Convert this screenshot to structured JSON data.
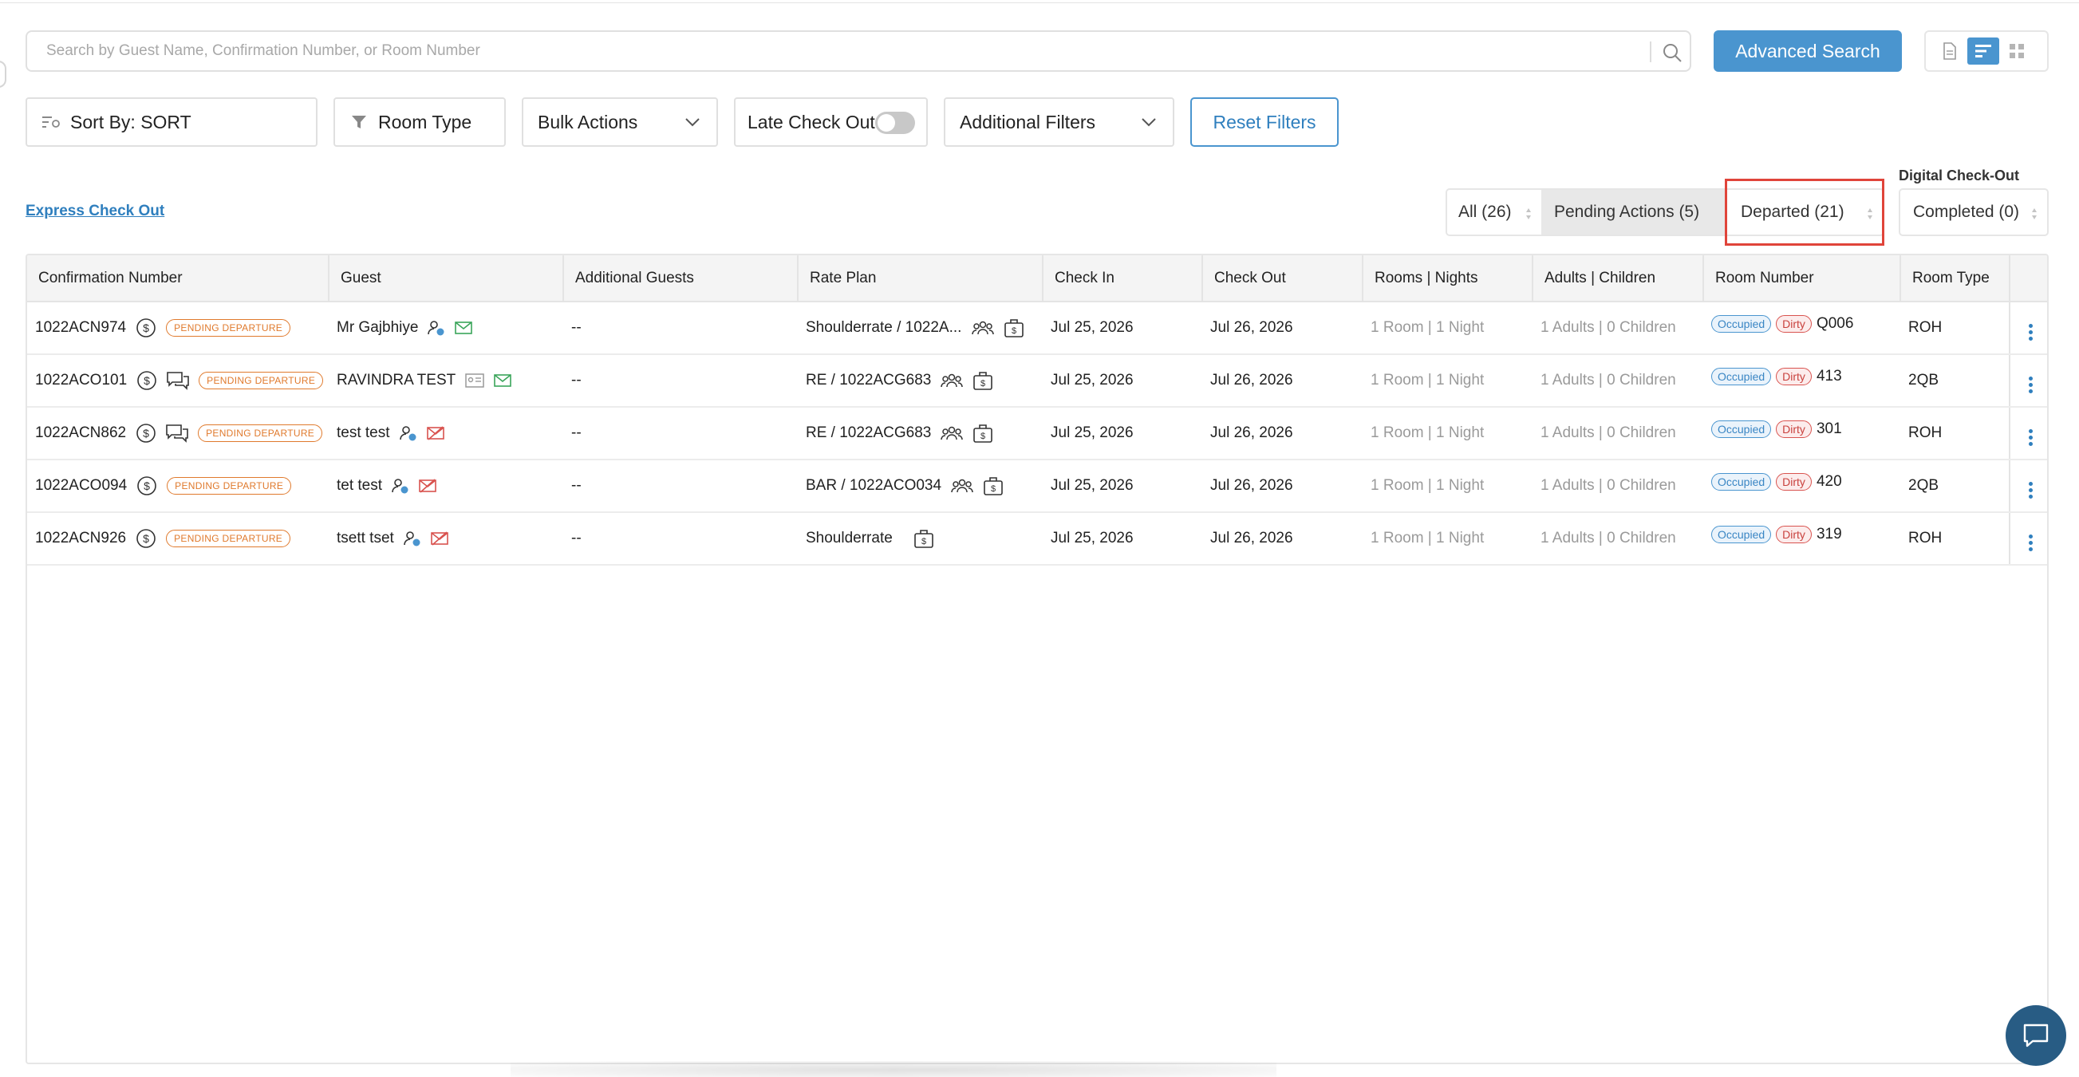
{
  "search": {
    "placeholder": "Search by Guest Name, Confirmation Number, or Room Number"
  },
  "advanced_search_label": "Advanced Search",
  "filters": {
    "sort_label": "Sort By: SORT",
    "room_type_label": "Room Type",
    "bulk_actions_label": "Bulk Actions",
    "late_checkout_label": "Late Check Out",
    "additional_filters_label": "Additional Filters",
    "reset_label": "Reset Filters"
  },
  "express_checkout_label": "Express Check Out",
  "tabs": {
    "all": "All (26)",
    "pending": "Pending Actions (5)",
    "departed": "Departed (21)",
    "digital_checkout_label": "Digital Check-Out",
    "completed": "Completed (0)"
  },
  "table": {
    "headers": [
      "Confirmation Number",
      "Guest",
      "Additional Guests",
      "Rate Plan",
      "Check In",
      "Check Out",
      "Rooms | Nights",
      "Adults | Children",
      "Room Number",
      "Room Type"
    ],
    "rows": [
      {
        "conf": "1022ACN974",
        "status": "PENDING DEPARTURE",
        "guest": "Mr Gajbhiye",
        "additional": "--",
        "rate_plan": "Shoulderrate / 1022A...",
        "check_in": "Jul 25, 2026",
        "check_out": "Jul 26, 2026",
        "rooms_nights": "1 Room | 1 Night",
        "adults_children": "1 Adults | 0 Children",
        "occupied": "Occupied",
        "dirty": "Dirty",
        "room_number": "Q006",
        "room_type": "ROH"
      },
      {
        "conf": "1022ACO101",
        "status": "PENDING DEPARTURE",
        "guest": "RAVINDRA TEST",
        "additional": "--",
        "rate_plan": "RE / 1022ACG683",
        "check_in": "Jul 25, 2026",
        "check_out": "Jul 26, 2026",
        "rooms_nights": "1 Room | 1 Night",
        "adults_children": "1 Adults | 0 Children",
        "occupied": "Occupied",
        "dirty": "Dirty",
        "room_number": "413",
        "room_type": "2QB"
      },
      {
        "conf": "1022ACN862",
        "status": "PENDING DEPARTURE",
        "guest": "test test",
        "additional": "--",
        "rate_plan": "RE / 1022ACG683",
        "check_in": "Jul 25, 2026",
        "check_out": "Jul 26, 2026",
        "rooms_nights": "1 Room | 1 Night",
        "adults_children": "1 Adults | 0 Children",
        "occupied": "Occupied",
        "dirty": "Dirty",
        "room_number": "301",
        "room_type": "ROH"
      },
      {
        "conf": "1022ACO094",
        "status": "PENDING DEPARTURE",
        "guest": "tet test",
        "additional": "--",
        "rate_plan": "BAR / 1022ACO034",
        "check_in": "Jul 25, 2026",
        "check_out": "Jul 26, 2026",
        "rooms_nights": "1 Room | 1 Night",
        "adults_children": "1 Adults | 0 Children",
        "occupied": "Occupied",
        "dirty": "Dirty",
        "room_number": "420",
        "room_type": "2QB"
      },
      {
        "conf": "1022ACN926",
        "status": "PENDING DEPARTURE",
        "guest": "tsett tset",
        "additional": "--",
        "rate_plan": "Shoulderrate",
        "check_in": "Jul 25, 2026",
        "check_out": "Jul 26, 2026",
        "rooms_nights": "1 Room | 1 Night",
        "adults_children": "1 Adults | 0 Children",
        "occupied": "Occupied",
        "dirty": "Dirty",
        "room_number": "319",
        "room_type": "ROH"
      }
    ]
  },
  "colors": {
    "accent": "#4a95cf",
    "pending": "#e07a2d",
    "dirty": "#d9534f",
    "highlight": "#e0443a",
    "chat": "#285c84"
  }
}
